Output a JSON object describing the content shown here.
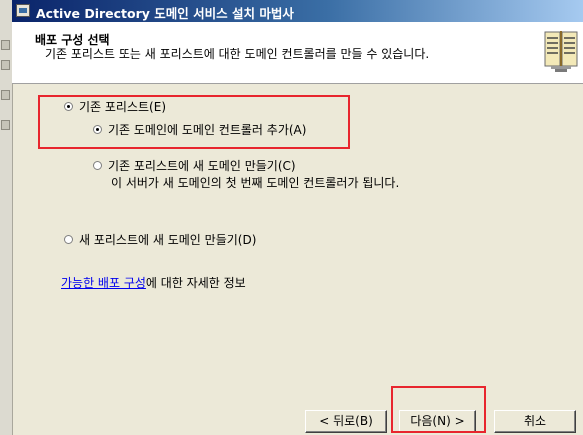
{
  "window": {
    "title": "Active Directory 도메인 서비스 설치 마법사"
  },
  "header": {
    "title": "배포 구성 선택",
    "subtitle": "기존 포리스트 또는 새 포리스트에 대한 도메인 컨트롤러를 만들 수 있습니다."
  },
  "options": {
    "existing_forest": {
      "label": "기존 포리스트(E)",
      "selected": true
    },
    "add_dc": {
      "label": "기존 도메인에 도메인 컨트롤러 추가(A)",
      "selected": true
    },
    "new_domain": {
      "label": "기존 포리스트에 새 도메인 만들기(C)",
      "description": "이 서버가 새 도메인의 첫 번째 도메인 컨트롤러가 됩니다.",
      "selected": false
    },
    "new_forest": {
      "label": "새 포리스트에 새 도메인 만들기(D)",
      "selected": false
    }
  },
  "info": {
    "link_text": "가능한 배포 구성",
    "suffix": "에 대한 자세한 정보"
  },
  "buttons": {
    "back": "< 뒤로(B)",
    "next": "다음(N) >",
    "cancel": "취소"
  },
  "colors": {
    "highlight_box": "#e8262e",
    "link": "#0000ee",
    "title_bar": "#0a246a"
  },
  "icons": {
    "title": "window-icon",
    "header": "book-icon"
  }
}
